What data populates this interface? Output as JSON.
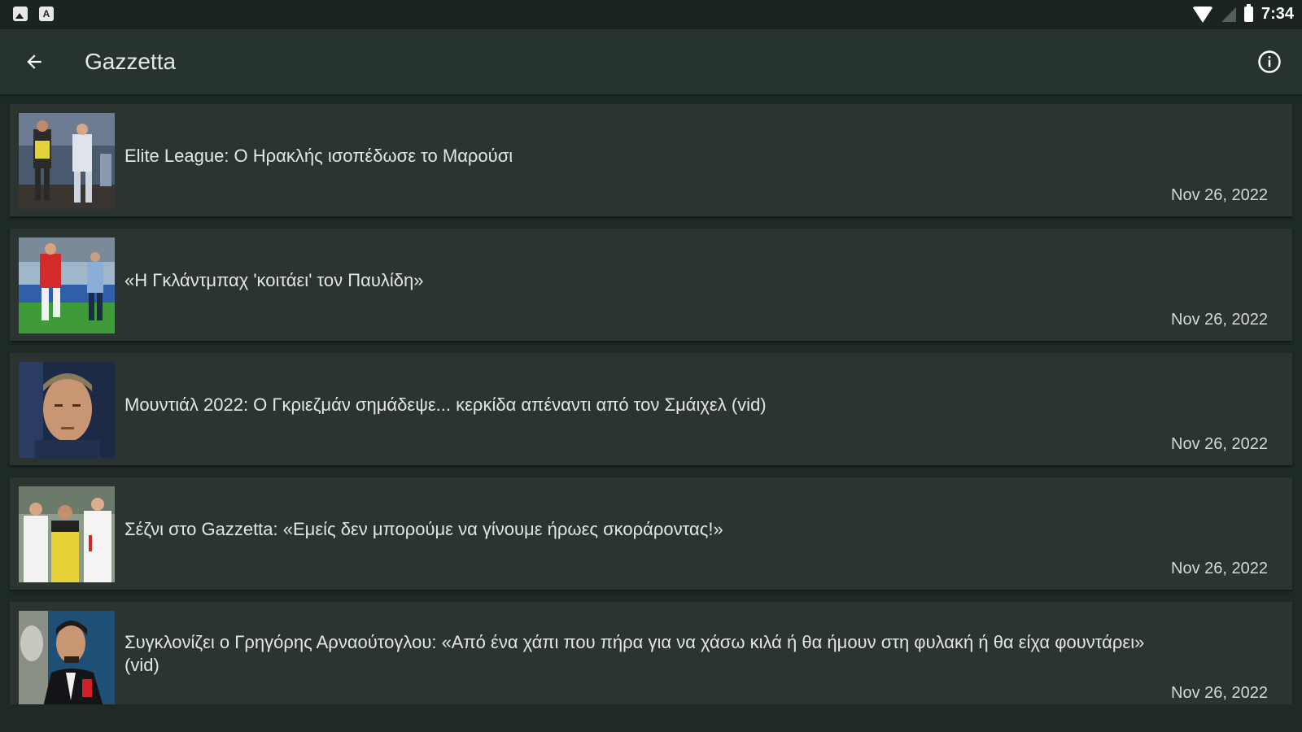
{
  "status_bar": {
    "left_icons": [
      "image-notification-icon",
      "font-notification-icon"
    ],
    "left_letter": "A",
    "right_icons": [
      "wifi-icon",
      "signal-icon",
      "battery-icon"
    ],
    "time": "7:34"
  },
  "app_bar": {
    "title": "Gazzetta",
    "back_icon": "arrow-back-icon",
    "info_icon": "info-icon"
  },
  "articles": [
    {
      "title": "Elite League: Ο Ηρακλής ισοπέδωσε το Μαρούσι",
      "date": "Nov 26, 2022",
      "thumbnail": "basketball-players-image"
    },
    {
      "title": "«Η Γκλάντμπαχ 'κοιτάει' τον Παυλίδη»",
      "date": "Nov 26, 2022",
      "thumbnail": "football-players-image"
    },
    {
      "title": "Μουντιάλ 2022: Ο Γκριεζμάν σημάδεψε... κερκίδα απέναντι από τον Σμάιχελ (vid)",
      "date": "Nov 26, 2022",
      "thumbnail": "player-portrait-image"
    },
    {
      "title": "Σέζνι στο Gazzetta: «Εμείς δεν μπορούμε να γίνουμε ήρωες σκοράροντας!»",
      "date": "Nov 26, 2022",
      "thumbnail": "football-celebration-image"
    },
    {
      "title": "Συγκλονίζει ο Γρηγόρης Αρναούτογλου: «Από ένα χάπι που πήρα για να χάσω κιλά ή θα ήμουν στη φυλακή ή θα είχα φουντάρει» (vid)",
      "date": "Nov 26, 2022",
      "thumbnail": "tv-presenter-image"
    }
  ],
  "colors": {
    "background": "#1e2a26",
    "app_bar": "#263330",
    "card": "#2c3431",
    "text": "#e2e6e4"
  }
}
